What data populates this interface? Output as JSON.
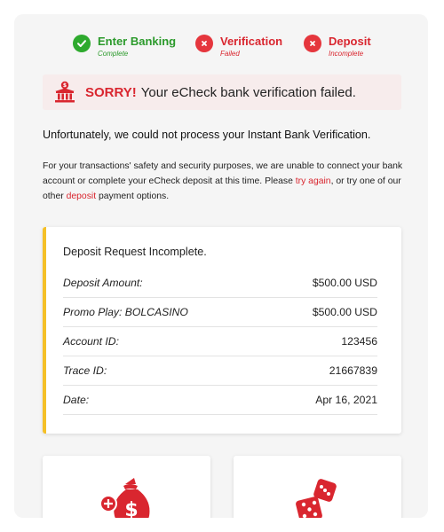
{
  "steps": [
    {
      "title": "Enter Banking",
      "status": "Complete",
      "state": "ok"
    },
    {
      "title": "Verification",
      "status": "Failed",
      "state": "fail"
    },
    {
      "title": "Deposit",
      "status": "Incomplete",
      "state": "fail"
    }
  ],
  "banner": {
    "sorry": "SORRY!",
    "message": "Your eCheck bank verification failed.",
    "icon": "bank-icon"
  },
  "headline": "Unfortunately, we could not process your Instant Bank Verification.",
  "para": {
    "part1": "For your transactions' safety and security purposes, we are unable to connect your bank account or complete your eCheck deposit at this time. Please ",
    "link1": "try again",
    "part2": ", or try one of our other ",
    "link2": "deposit",
    "part3": " payment options."
  },
  "summary": {
    "title": "Deposit Request Incomplete.",
    "rows": [
      {
        "label": "Deposit Amount:",
        "value": "$500.00 USD"
      },
      {
        "label": "Promo Play: BOLCASINO",
        "value": "$500.00 USD"
      },
      {
        "label": "Account ID:",
        "value": "123456"
      },
      {
        "label": "Trace ID:",
        "value": "21667839"
      },
      {
        "label": "Date:",
        "value": "Apr 16, 2021"
      }
    ]
  },
  "options": [
    {
      "icon": "money-bag-plus-icon"
    },
    {
      "icon": "dice-icon"
    }
  ],
  "colors": {
    "success": "#2eaa2e",
    "error": "#d9262f",
    "accent_bar": "#f5c027",
    "banner_bg": "#f7ecec"
  }
}
